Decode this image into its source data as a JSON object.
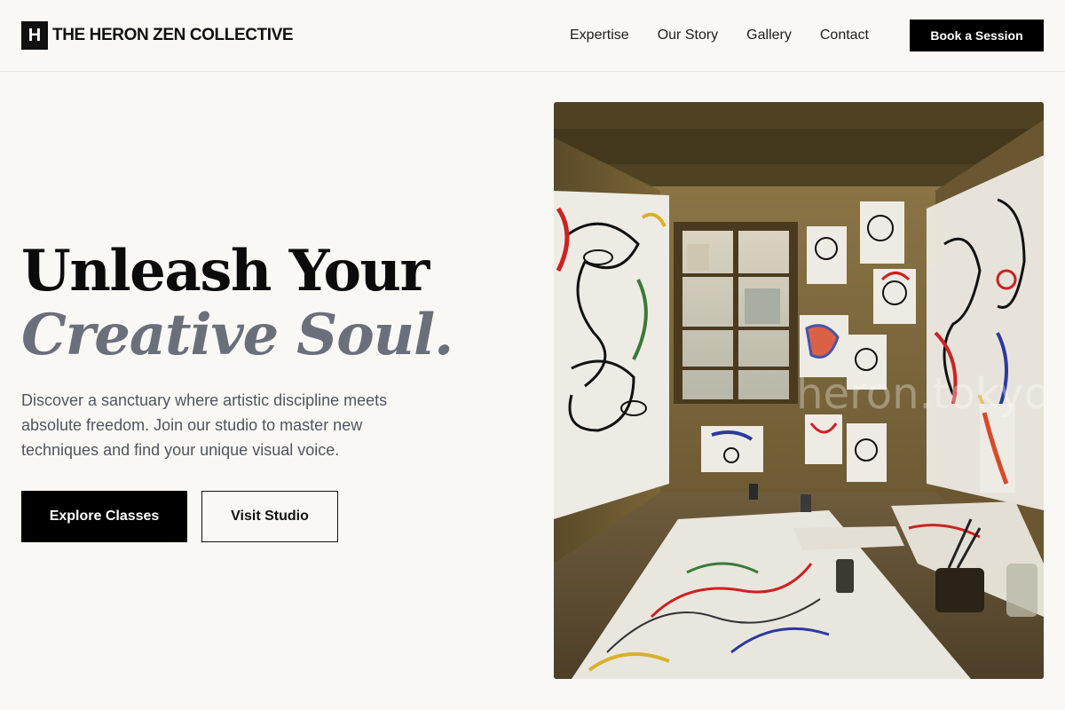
{
  "header": {
    "logo_mark": "H",
    "brand": "THE HERON ZEN COLLECTIVE",
    "nav": [
      {
        "label": "Expertise"
      },
      {
        "label": "Our Story"
      },
      {
        "label": "Gallery"
      },
      {
        "label": "Contact"
      }
    ],
    "cta_label": "Book a Session"
  },
  "hero": {
    "title_line1": "Unleash Your",
    "title_line2": "Creative Soul.",
    "description": "Discover a sanctuary where artistic discipline meets absolute freedom. Join our studio to master new techniques and find your unique visual voice.",
    "primary_button": "Explore Classes",
    "secondary_button": "Visit Studio"
  },
  "image": {
    "watermark": "heron.tokyo"
  },
  "colors": {
    "background": "#f9f8f4",
    "primary": "#000000",
    "accent_text": "#6b6f7b",
    "body_text": "#4f5560"
  }
}
